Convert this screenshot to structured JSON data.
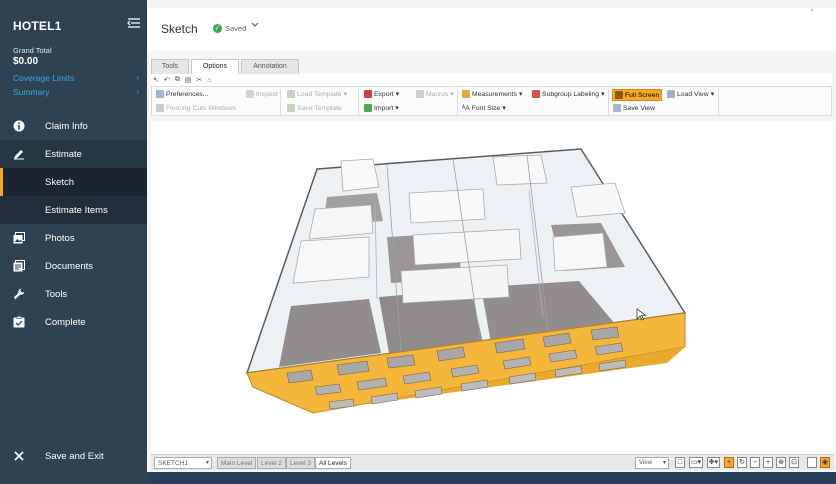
{
  "sidebar": {
    "claim_title": "HOTEL1",
    "grand_total_label": "Grand Total",
    "grand_total_value": "$0.00",
    "links": [
      {
        "label": "Coverage Limits",
        "chevron": "›"
      },
      {
        "label": "Summary",
        "chevron": "›"
      }
    ],
    "nav": {
      "claim_info": {
        "label": "Claim Info",
        "icon": "info-icon"
      },
      "estimate": {
        "label": "Estimate",
        "icon": "edit-icon"
      },
      "sketch": {
        "label": "Sketch"
      },
      "estimate_items": {
        "label": "Estimate Items"
      },
      "photos": {
        "label": "Photos",
        "icon": "photos-icon"
      },
      "documents": {
        "label": "Documents",
        "icon": "documents-icon"
      },
      "tools": {
        "label": "Tools",
        "icon": "wrench-icon"
      },
      "complete": {
        "label": "Complete",
        "icon": "checklist-icon"
      },
      "save_exit": {
        "label": "Save and Exit",
        "icon": "close-icon"
      }
    }
  },
  "header": {
    "title": "Sketch",
    "status": "Saved",
    "status_icon": "check-icon",
    "dropdown_icon": "chevron-down-icon",
    "close_glyph": "×"
  },
  "ribbon": {
    "tabs": [
      {
        "label": "Tools"
      },
      {
        "label": "Options"
      },
      {
        "label": "Annotation"
      }
    ],
    "active_tab": "Options",
    "buttons": {
      "preferences": "Preferences...",
      "inspect": "Inspect",
      "flooring_cuts": "Flooring Cuts Windows",
      "load_template": "Load Template",
      "save_template": "Save Template",
      "export": "Export",
      "import": "Import",
      "macros": "Macros",
      "measurements": "Measurements",
      "font_size": "Font Size",
      "subgroup_labeling": "Subgroup Labeling",
      "full_screen": "Full Screen",
      "save_view": "Save View",
      "load_view": "Load View"
    }
  },
  "statusbar": {
    "sketch_name": "SKETCH1",
    "levels": [
      {
        "label": "Main Level"
      },
      {
        "label": "Level 2"
      },
      {
        "label": "Level 3"
      },
      {
        "label": "All Levels"
      }
    ],
    "active_level": "All Levels",
    "view_select": "View"
  },
  "colors": {
    "sidebar_bg": "#2f4252",
    "accent_link": "#32a8e0",
    "active_marker": "#f5a623",
    "facade": "#f4b73c",
    "floor": "#908c8c",
    "saved_green": "#3aa655"
  }
}
